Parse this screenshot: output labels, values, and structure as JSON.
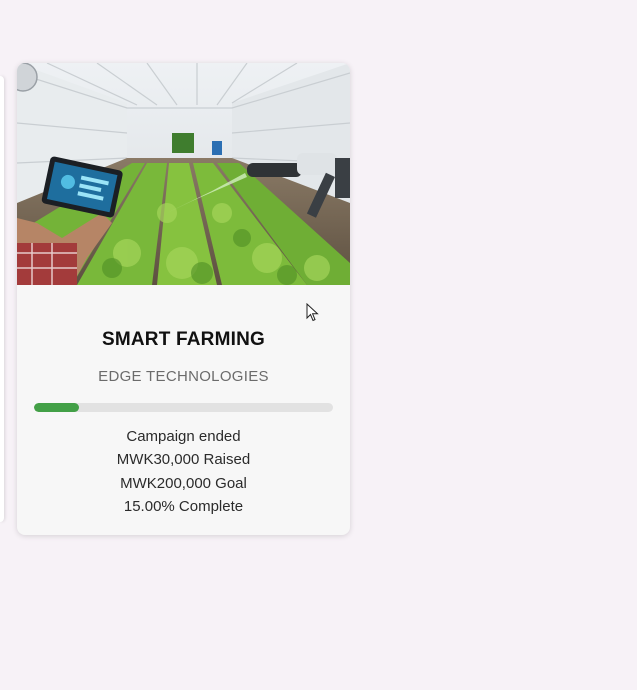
{
  "campaign": {
    "title": "SMART FARMING",
    "organization": "EDGE TECHNOLOGIES",
    "status": "Campaign ended",
    "raised": "MWK30,000 Raised",
    "goal": "MWK200,000 Goal",
    "complete": "15.00% Complete",
    "progress_fraction": 0.15
  },
  "colors": {
    "progress": "#43a047",
    "track": "#e2e2e2",
    "page_background": "#f7f2f7"
  },
  "icons": {
    "cursor": "arrow-pointer-icon"
  }
}
